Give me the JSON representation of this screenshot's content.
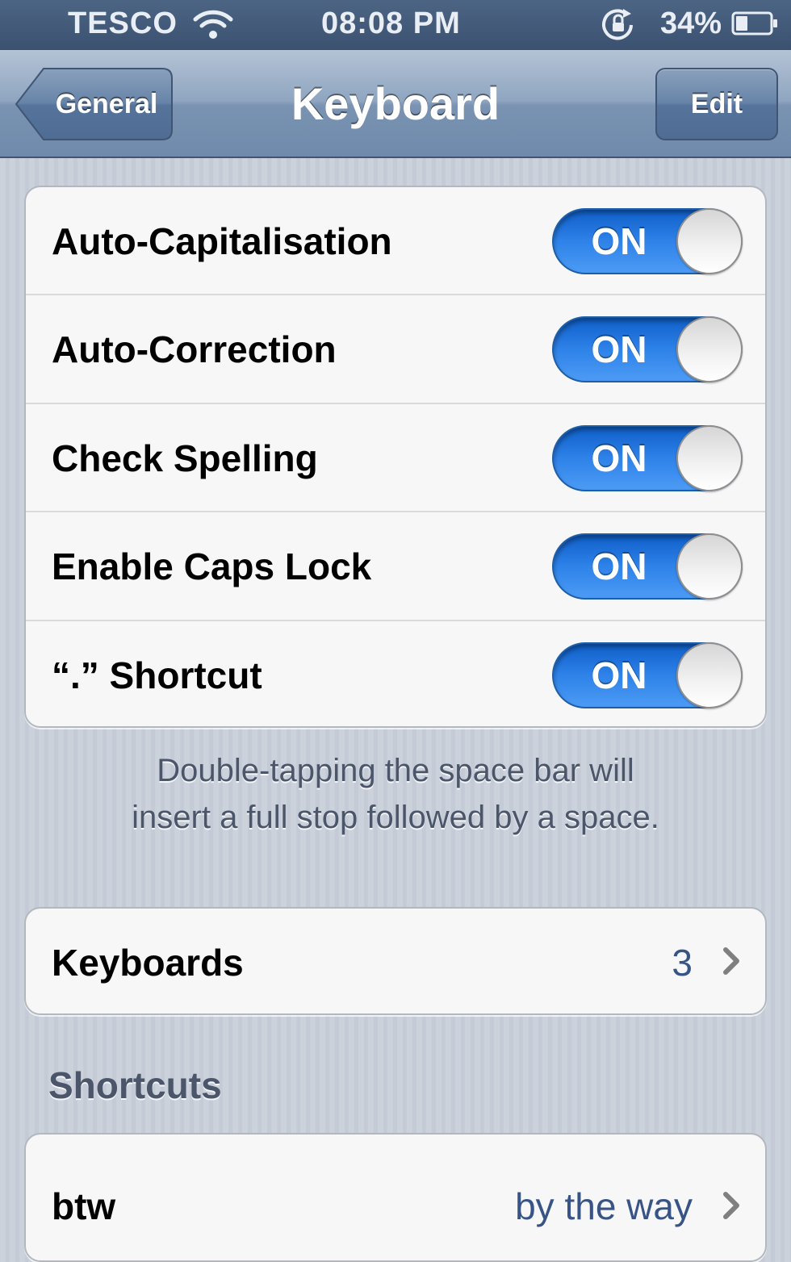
{
  "status_bar": {
    "carrier": "TESCO",
    "time": "08:08 PM",
    "battery_percent": "34%",
    "battery_level": 0.34,
    "icons": [
      "signal-dots-icon",
      "wifi-icon",
      "rotation-lock-icon",
      "battery-icon"
    ]
  },
  "nav": {
    "back_label": "General",
    "title": "Keyboard",
    "edit_label": "Edit"
  },
  "settings": [
    {
      "label": "Auto-Capitalisation",
      "state": "ON"
    },
    {
      "label": "Auto-Correction",
      "state": "ON"
    },
    {
      "label": "Check Spelling",
      "state": "ON"
    },
    {
      "label": "Enable Caps Lock",
      "state": "ON"
    },
    {
      "label": "“.” Shortcut",
      "state": "ON"
    }
  ],
  "footnote": {
    "line1": "Double-tapping the space bar will",
    "line2": "insert a full stop followed by a space."
  },
  "keyboards": {
    "label": "Keyboards",
    "count": "3"
  },
  "shortcuts": {
    "header": "Shortcuts",
    "first": {
      "phrase": "btw",
      "expansion": "by the way"
    }
  },
  "colors": {
    "switch_on": "#2e82e8",
    "nav_bar": "#7a93b2",
    "status_bar": "#3a5170",
    "value_text": "#385487"
  }
}
